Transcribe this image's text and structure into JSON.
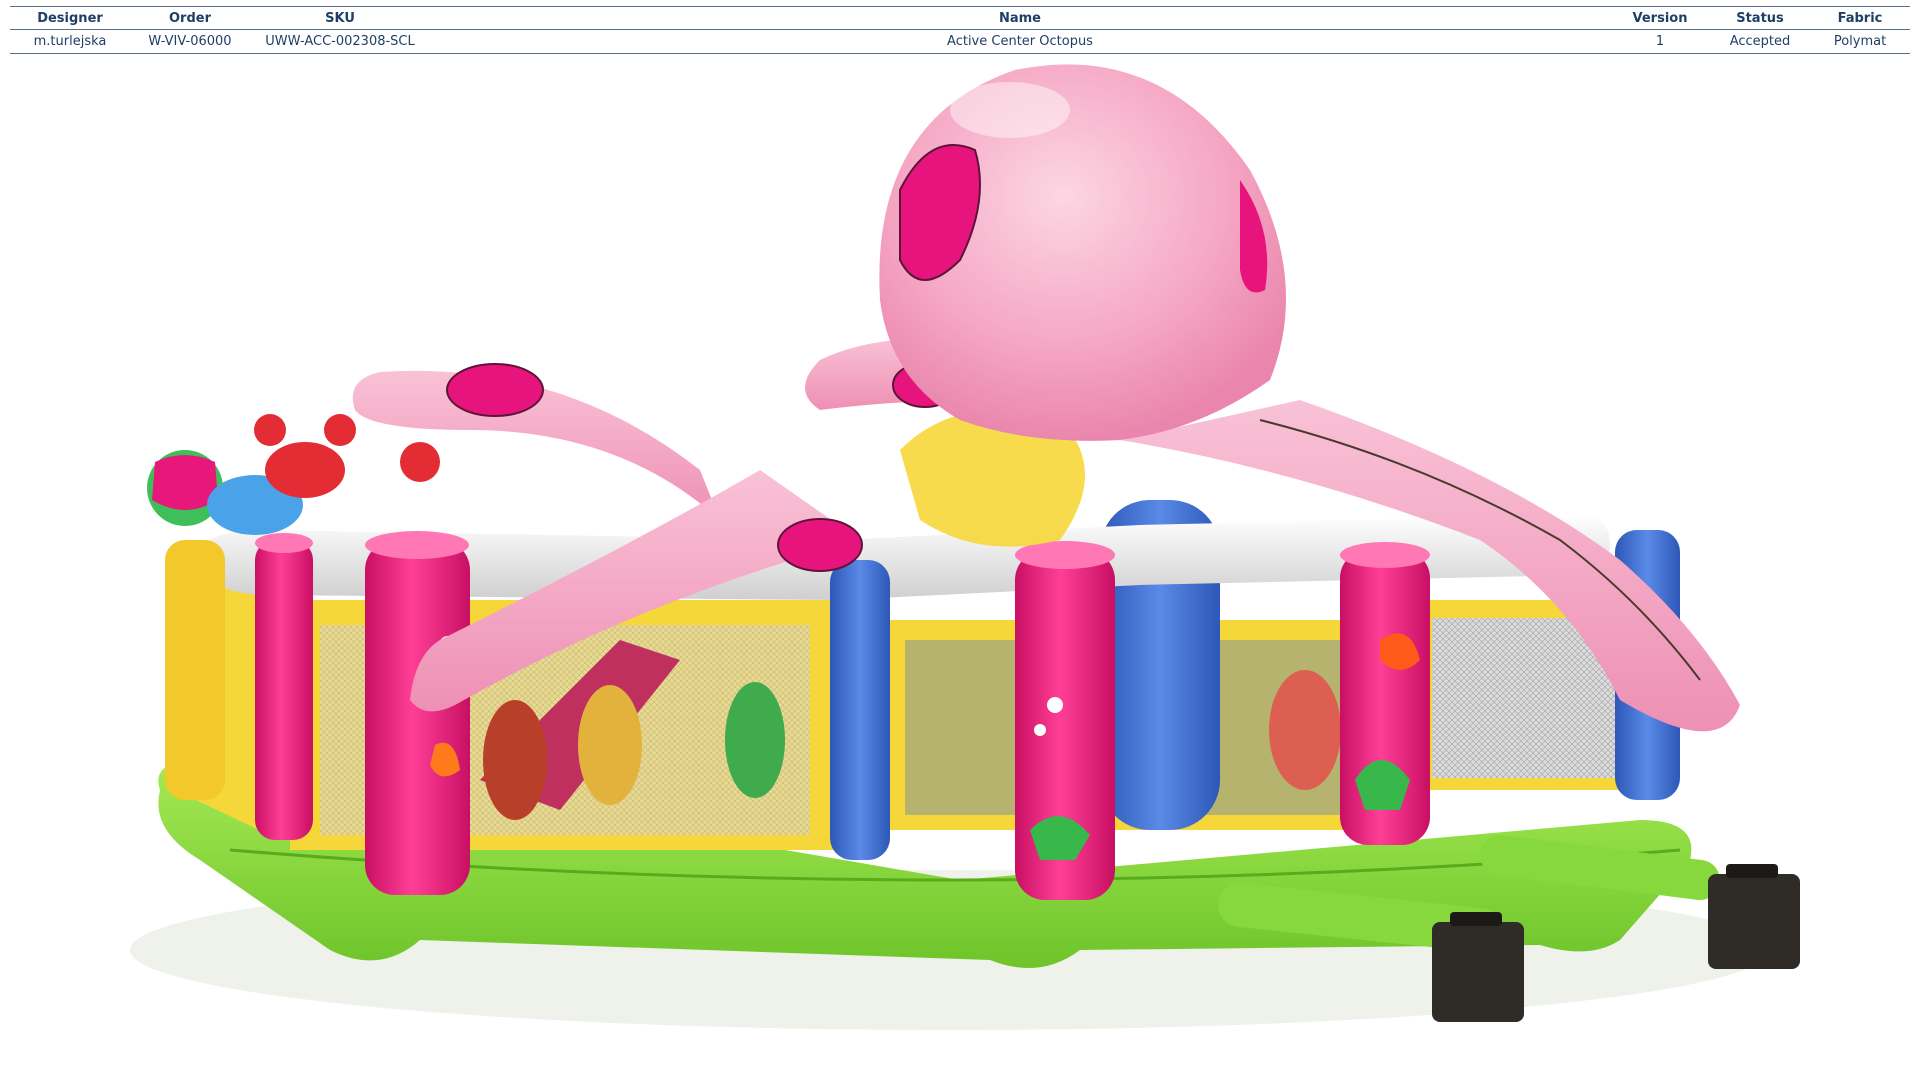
{
  "header": {
    "columns": [
      "Designer",
      "Order",
      "SKU",
      "Name",
      "Version",
      "Status",
      "Fabric"
    ],
    "row": [
      "m.turlejska",
      "W-VIV-06000",
      "UWW-ACC-002308-SCL",
      "Active Center Octopus",
      "1",
      "Accepted",
      "Polymat"
    ]
  },
  "colors": {
    "header_text": "#1f3f66",
    "octopus_pink": "#f4a6c2",
    "spot_magenta": "#e8147e",
    "wall_pink": "#e8187a",
    "base_green": "#8fdc3e",
    "rim_white": "#eeeeee",
    "yellow": "#f6d73a",
    "blue": "#3f70d0"
  },
  "product_image": {
    "subject": "inflatable octopus play center",
    "blowers": 2
  }
}
